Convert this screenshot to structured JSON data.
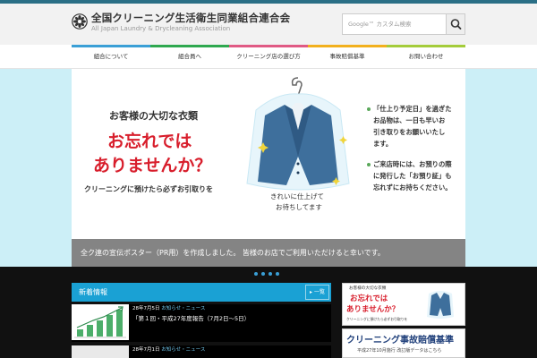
{
  "header": {
    "title": "全国クリーニング生活衛生同業組合連合会",
    "subtitle": "All Japan Laundry & Drycleaning Association"
  },
  "search": {
    "placeholder": "Google™ カスタム検索"
  },
  "nav": [
    {
      "label": "組合について",
      "color": "#3a9fd6"
    },
    {
      "label": "組合員へ",
      "color": "#2fa84f"
    },
    {
      "label": "クリーニング店の選び方",
      "color": "#e05a84"
    },
    {
      "label": "事故賠償基準",
      "color": "#f2b01d"
    },
    {
      "label": "お問い合わせ",
      "color": "#a4cc3a"
    }
  ],
  "slide": {
    "line1": "お客様の大切な衣類",
    "line2": "お忘れでは",
    "line3": "ありませんか？",
    "line4": "クリーニングに預けたら必ずお引取りを",
    "jacket_caption1": "きれいに仕上げて",
    "jacket_caption2": "お待ちしてます",
    "right1": [
      "「仕上り予定日」を過ぎた",
      "お品物は、一日も早いお",
      "引き取りをお願いいたし",
      "ます。"
    ],
    "right2": [
      "ご来店時には、お預りの際",
      "に発行した「お預り証」も",
      "忘れずにお持ちください。"
    ],
    "caption": "全ク連の宣伝ポスター（PR用）を作成しました。 皆様のお店でご利用いただけると幸いです。"
  },
  "slider": {
    "dots": 4,
    "active": 0
  },
  "news": {
    "heading": "新着情報",
    "list_label": "一覧",
    "items": [
      {
        "date": "28年7月5日",
        "category": "お知らせ・ニュース",
        "title": "「第１回・平成27年度報告（7月2日〜5日）"
      },
      {
        "date": "28年7月1日",
        "category": "お知らせ・ニュース",
        "title": ""
      }
    ]
  },
  "banner1": {
    "line1": "お客様の大切な衣類",
    "line2": "お忘れでは",
    "line3": "ありませんか？",
    "line4": "クリーニングに預けたら必ずお引取りを"
  },
  "banner2": {
    "title": "クリーニング事故賠償基準",
    "sub": "平成27年10月施行 改訂版データはこちら"
  }
}
